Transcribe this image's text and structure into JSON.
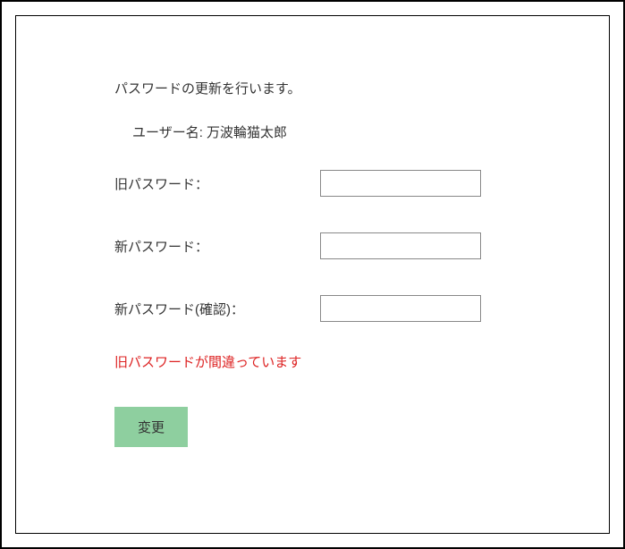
{
  "heading": "パスワードの更新を行います。",
  "user": {
    "label": "ユーザー名:",
    "value": "万波輪猫太郎"
  },
  "fields": {
    "old_password": {
      "label": "旧パスワード：",
      "value": ""
    },
    "new_password": {
      "label": "新パスワード：",
      "value": ""
    },
    "new_password_confirm": {
      "label": "新パスワード(確認)：",
      "value": ""
    }
  },
  "error": "旧パスワードが間違っています",
  "buttons": {
    "change": "変更"
  }
}
